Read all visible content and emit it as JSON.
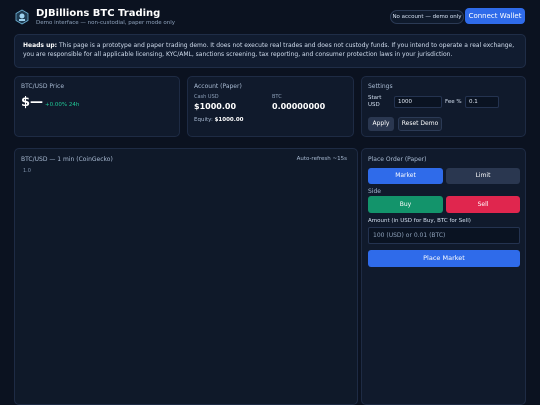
{
  "header": {
    "title": "DJBillions BTC Trading",
    "subtitle": "Demo interface — non-custodial, paper mode only",
    "demo_pill": "No account — demo only",
    "connect_label": "Connect Wallet"
  },
  "banner": {
    "lead": "Heads up:",
    "text": " This page is a prototype and paper trading demo. It does not execute real trades and does not custody funds. If you intend to operate a real exchange, you are responsible for all applicable licensing, KYC/AML, sanctions screening, tax reporting, and consumer protection laws in your jurisdiction."
  },
  "price": {
    "label": "BTC/USD Price",
    "value": "$—",
    "change": "+0.00% 24h"
  },
  "account": {
    "title": "Account (Paper)",
    "cash_label": "Cash USD",
    "cash_value": "$1000.00",
    "btc_label": "BTC",
    "btc_value": "0.00000000",
    "equity_label": "Equity:",
    "equity_value": "$1000.00"
  },
  "settings": {
    "title": "Settings",
    "start_label": "Start USD",
    "start_value": "1000",
    "fee_label": "Fee %",
    "fee_value": "0.1",
    "apply_label": "Apply",
    "reset_label": "Reset Demo"
  },
  "chart": {
    "title": "BTC/USD — 1 min (CoinGecko)",
    "refresh": "Auto-refresh ~15s",
    "y_tick": "1.0"
  },
  "order": {
    "title": "Place Order (Paper)",
    "market_label": "Market",
    "limit_label": "Limit",
    "side_label": "Side",
    "buy_label": "Buy",
    "sell_label": "Sell",
    "amount_label": "Amount (in USD for Buy, BTC for Sell)",
    "amount_placeholder": "100 (USD) or 0.01 (BTC)",
    "submit_label": "Place Market"
  },
  "colors": {
    "accent": "#2f6bea",
    "buy": "#13946b",
    "sell": "#e0264e",
    "positive": "#20c997"
  }
}
